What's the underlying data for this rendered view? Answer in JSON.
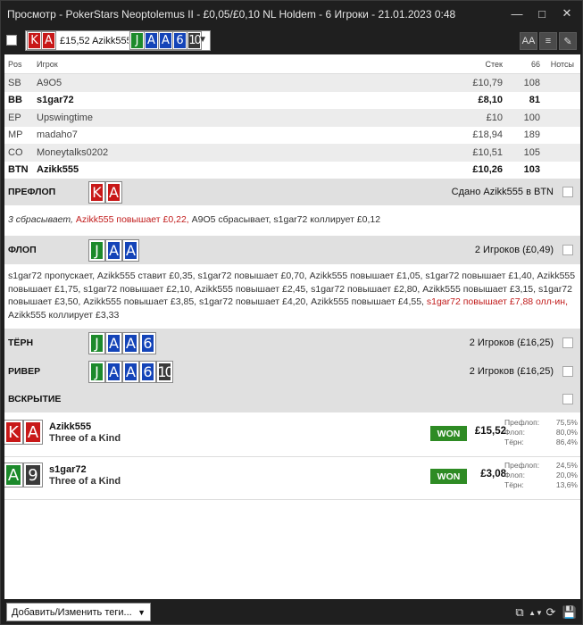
{
  "window": {
    "title": "Просмотр - PokerStars Neoptolemus II - £0,05/£0,10 NL Holdem - 6 Игроки - 21.01.2023 0:48"
  },
  "toolbar": {
    "hand_text": "£15,52 Azikk555",
    "hand_cards": [
      {
        "r": "K",
        "s": "hs"
      },
      {
        "r": "A",
        "s": "hs"
      }
    ],
    "board_cards": [
      {
        "r": "J",
        "s": "cl"
      },
      {
        "r": "A",
        "s": "dm"
      },
      {
        "r": "A",
        "s": "dm"
      },
      {
        "r": "6",
        "s": "dm"
      },
      {
        "r": "10",
        "s": "sp"
      }
    ],
    "font_btn": "AA"
  },
  "table": {
    "headers": {
      "pos": "Pos",
      "player": "Игрок",
      "stack": "Стек",
      "c66": "66",
      "notes": "Нотсы"
    },
    "rows": [
      {
        "pos": "SB",
        "player": "A9O5",
        "stack": "£10,79",
        "c66": "108",
        "bold": false
      },
      {
        "pos": "BB",
        "player": "s1gar72",
        "stack": "£8,10",
        "c66": "81",
        "bold": true
      },
      {
        "pos": "EP",
        "player": "Upswingtime",
        "stack": "£10",
        "c66": "100",
        "bold": false
      },
      {
        "pos": "MP",
        "player": "madaho7",
        "stack": "£18,94",
        "c66": "189",
        "bold": false
      },
      {
        "pos": "CO",
        "player": "Moneytalks0202",
        "stack": "£10,51",
        "c66": "105",
        "bold": false
      },
      {
        "pos": "BTN",
        "player": "Azikk555",
        "stack": "£10,26",
        "c66": "103",
        "bold": true
      }
    ]
  },
  "preflop": {
    "label": "ПРЕФЛОП",
    "dealt": "Сдано Azikk555 в BTN",
    "a1": "3 сбрасывает,",
    "a2": "Azikk555 повышает £0,22,",
    "a3": "A9O5 сбрасывает, s1gar72 коллирует £0,12"
  },
  "flop": {
    "label": "ФЛОП",
    "players": "2 Игроков (£0,49)",
    "a1": "s1gar72 пропускает, Azikk555 ставит £0,35, s1gar72 повышает £0,70, Azikk555 повышает £1,05, s1gar72 повышает £1,40, Azikk555 повышает £1,75, s1gar72 повышает £2,10, Azikk555 повышает £2,45, s1gar72 повышает £2,80, Azikk555 повышает £3,15, s1gar72 повышает £3,50, Azikk555 повышает £3,85, s1gar72 повышает £4,20, Azikk555 повышает £4,55,",
    "a2": "s1gar72 повышает £7,88 олл-ин,",
    "a3": "Azikk555 коллирует £3,33"
  },
  "turn": {
    "label": "ТЁРН",
    "players": "2 Игроков (£16,25)"
  },
  "river": {
    "label": "РИВЕР",
    "players": "2 Игроков (£16,25)"
  },
  "showdown": {
    "label": "ВСКРЫТИЕ",
    "players": [
      {
        "name": "Azikk555",
        "hand": "Three of a Kind",
        "won": "WON",
        "amount": "£15,52",
        "cards": [
          {
            "r": "K",
            "s": "hs"
          },
          {
            "r": "A",
            "s": "hs"
          }
        ],
        "eq": [
          {
            "k": "Префлоп:",
            "v": "75,5%"
          },
          {
            "k": "Флоп:",
            "v": "80,0%"
          },
          {
            "k": "Тёрн:",
            "v": "86,4%"
          }
        ]
      },
      {
        "name": "s1gar72",
        "hand": "Three of a Kind",
        "won": "WON",
        "amount": "£3,08",
        "cards": [
          {
            "r": "A",
            "s": "cl"
          },
          {
            "r": "9",
            "s": "sp"
          }
        ],
        "eq": [
          {
            "k": "Префлоп:",
            "v": "24,5%"
          },
          {
            "k": "Флоп:",
            "v": "20,0%"
          },
          {
            "k": "Тёрн:",
            "v": "13,6%"
          }
        ]
      }
    ]
  },
  "bottom": {
    "tags": "Добавить/Изменить теги..."
  }
}
